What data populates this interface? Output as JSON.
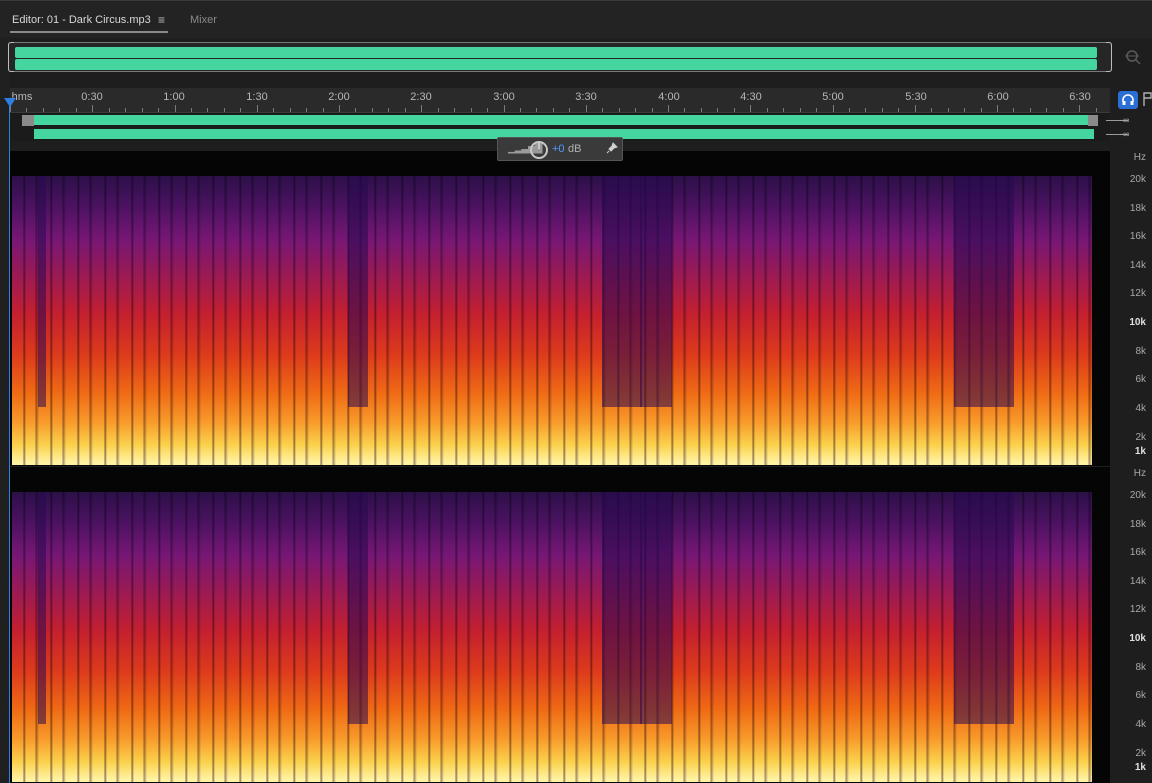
{
  "tabs": {
    "editor_label": "Editor: 01 - Dark Circus.mp3",
    "menu_glyph": "≡",
    "mixer_label": "Mixer"
  },
  "icons": {
    "zoom": "zoom-icon",
    "headphones": "headphones-icon",
    "pin": "pin-icon",
    "playhead": "playhead-icon"
  },
  "colors": {
    "waveform": "#45d6a0",
    "playhead": "#2f7ee0",
    "accent_blue": "#4e9dff"
  },
  "ruler": {
    "unit": "hms",
    "labels": [
      "0:30",
      "1:00",
      "1:30",
      "2:00",
      "2:30",
      "3:00",
      "3:30",
      "4:00",
      "4:30",
      "5:00",
      "5:30",
      "6:00",
      "6:30"
    ]
  },
  "meters": {
    "left": "-∞",
    "right": "-∞"
  },
  "hud": {
    "gain_value": "+0",
    "gain_unit": "dB"
  },
  "spectrogram": {
    "unit_label": "Hz",
    "channels": [
      {
        "name": "channel-1",
        "freq_labels": [
          "20k",
          "18k",
          "16k",
          "14k",
          "12k",
          "10k",
          "8k",
          "6k",
          "4k",
          "2k",
          "1k"
        ]
      },
      {
        "name": "channel-2",
        "freq_labels": [
          "20k",
          "18k",
          "16k",
          "14k",
          "12k",
          "10k",
          "8k",
          "6k",
          "4k",
          "2k",
          "1k"
        ]
      }
    ]
  }
}
